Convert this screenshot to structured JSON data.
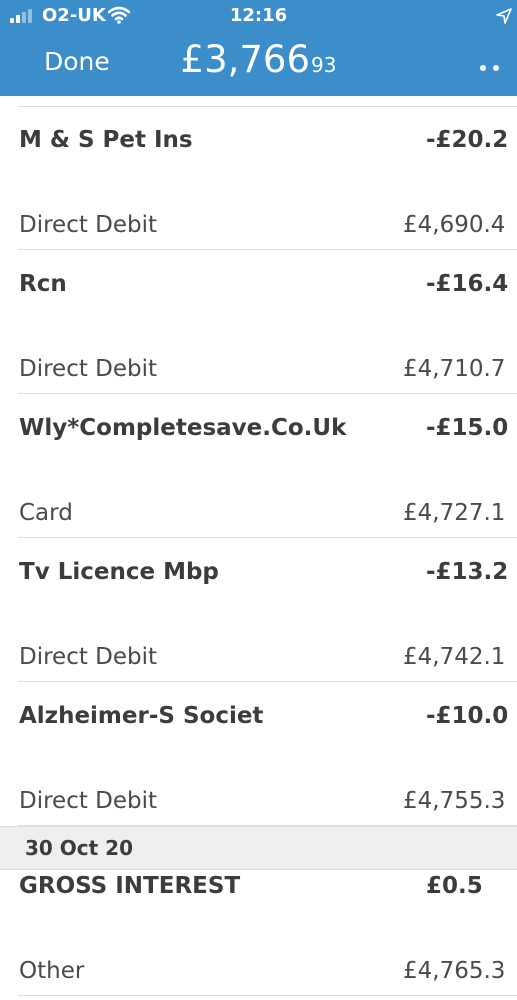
{
  "status_bar": {
    "carrier": "O2-UK",
    "time": "12:16",
    "icons": [
      "signal-icon",
      "wifi-icon",
      "location-arrow-icon"
    ]
  },
  "nav": {
    "done_label": "Done",
    "balance_main": "£3,766",
    "balance_pence": "93",
    "more_icon": "ellipsis-icon"
  },
  "colors": {
    "header_bg": "#3c8ecb",
    "header_text": "#ffffff",
    "date_header_bg": "#efefef"
  },
  "transactions_before": [
    {
      "name": "M & S Pet Ins",
      "amount": "-£20.2",
      "type": "Direct Debit",
      "balance": "£4,690.4"
    },
    {
      "name": "Rcn",
      "amount": "-£16.4",
      "type": "Direct Debit",
      "balance": "£4,710.7"
    },
    {
      "name": "Wly*Completesave.Co.Uk",
      "amount": "-£15.0",
      "type": "Card",
      "balance": "£4,727.1"
    },
    {
      "name": "Tv Licence Mbp",
      "amount": "-£13.2",
      "type": "Direct Debit",
      "balance": "£4,742.1"
    },
    {
      "name": "Alzheimer-S Societ",
      "amount": "-£10.0",
      "type": "Direct Debit",
      "balance": "£4,755.3"
    }
  ],
  "date_header": "30 Oct 20",
  "transactions_after": [
    {
      "name": "GROSS INTEREST",
      "amount": "£0.5",
      "type": "Other",
      "balance": "£4,765.3"
    }
  ]
}
